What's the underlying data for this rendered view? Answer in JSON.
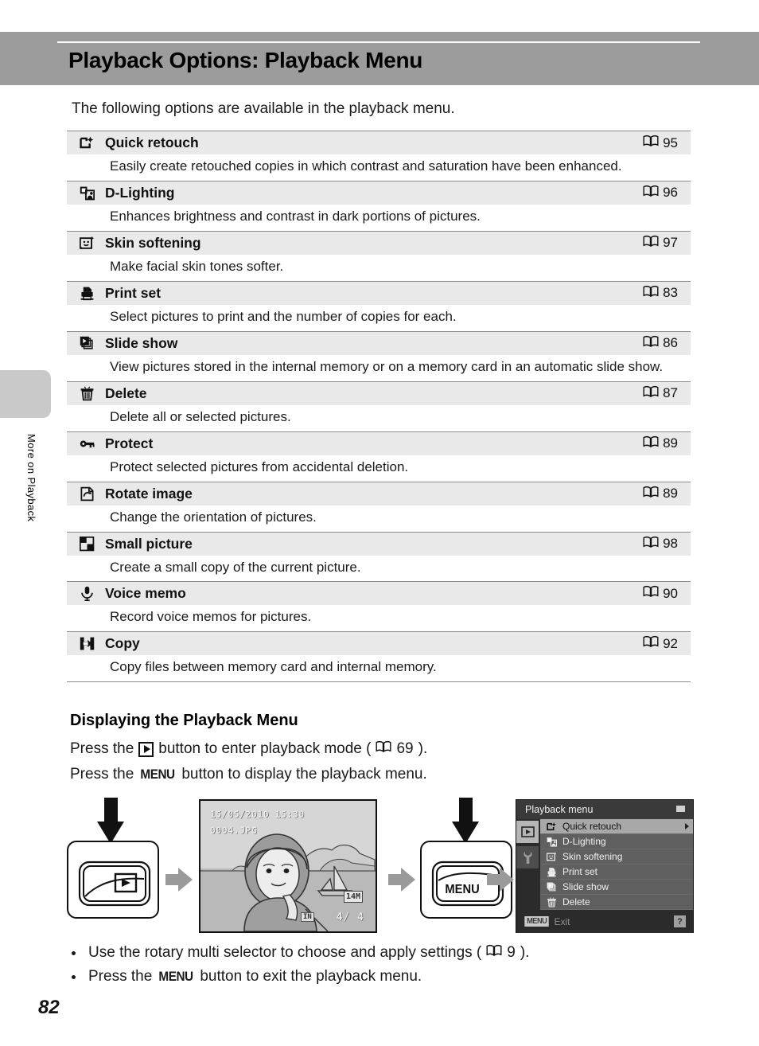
{
  "header": {
    "title": "Playback Options: Playback Menu"
  },
  "side_tab": {
    "label": "More on Playback"
  },
  "intro": "The following options are available in the playback menu.",
  "options_table": {
    "rows": [
      {
        "icon": "quick-retouch-icon",
        "name": "Quick retouch",
        "ref_icon": "book-icon",
        "ref_page": "95",
        "description": "Easily create retouched copies in which contrast and saturation have been enhanced."
      },
      {
        "icon": "d-lighting-icon",
        "name": "D-Lighting",
        "ref_icon": "book-icon",
        "ref_page": "96",
        "description": "Enhances brightness and contrast in dark portions of pictures."
      },
      {
        "icon": "skin-softening-icon",
        "name": "Skin softening",
        "ref_icon": "book-icon",
        "ref_page": "97",
        "description": "Make facial skin tones softer."
      },
      {
        "icon": "print-set-icon",
        "name": "Print set",
        "ref_icon": "book-icon",
        "ref_page": "83",
        "description": "Select pictures to print and the number of copies for each."
      },
      {
        "icon": "slide-show-icon",
        "name": "Slide show",
        "ref_icon": "book-icon",
        "ref_page": "86",
        "description": "View pictures stored in the internal memory or on a memory card in an automatic slide show."
      },
      {
        "icon": "delete-icon",
        "name": "Delete",
        "ref_icon": "book-icon",
        "ref_page": "87",
        "description": "Delete all or selected pictures."
      },
      {
        "icon": "protect-icon",
        "name": "Protect",
        "ref_icon": "book-icon",
        "ref_page": "89",
        "description": "Protect selected pictures from accidental deletion."
      },
      {
        "icon": "rotate-image-icon",
        "name": "Rotate image",
        "ref_icon": "book-icon",
        "ref_page": "89",
        "description": "Change the orientation of pictures."
      },
      {
        "icon": "small-picture-icon",
        "name": "Small picture",
        "ref_icon": "book-icon",
        "ref_page": "98",
        "description": "Create a small copy of the current picture."
      },
      {
        "icon": "voice-memo-icon",
        "name": "Voice memo",
        "ref_icon": "book-icon",
        "ref_page": "90",
        "description": "Record voice memos for pictures."
      },
      {
        "icon": "copy-icon",
        "name": "Copy",
        "ref_icon": "book-icon",
        "ref_page": "92",
        "description": "Copy files between memory card and internal memory."
      }
    ]
  },
  "section": {
    "heading": "Displaying the Playback Menu",
    "press_playback": {
      "before": "Press the",
      "button_icon": "playback-button-icon",
      "after": "button to enter playback mode (",
      "ref_icon": "book-icon",
      "ref_page": "69",
      "close": ")."
    },
    "press_menu": {
      "before": "Press the",
      "button_label": "MENU",
      "after": "button to display the playback menu."
    }
  },
  "flow": {
    "playback_button": {
      "label_icon": "playback-triangle-icon",
      "arrow": "press-arrow-down"
    },
    "lcd": {
      "date": "15/05/2010 15:30",
      "filename": "0004.JPG",
      "image_size_badge": "14M",
      "memory_badge": "IN",
      "frame_counter": "4/  4"
    },
    "menu_button": {
      "label": "MENU",
      "arrow": "press-arrow-down"
    },
    "menu_screen": {
      "title": "Playback menu",
      "battery_icon": "battery-icon",
      "tabs": [
        {
          "icon": "playback-tab-icon",
          "selected": true
        },
        {
          "icon": "setup-wrench-tab-icon",
          "selected": false
        }
      ],
      "items": [
        {
          "icon": "quick-retouch-icon",
          "label": "Quick retouch",
          "selected": true
        },
        {
          "icon": "d-lighting-icon",
          "label": "D-Lighting",
          "selected": false
        },
        {
          "icon": "skin-softening-icon",
          "label": "Skin softening",
          "selected": false
        },
        {
          "icon": "print-set-icon",
          "label": "Print set",
          "selected": false
        },
        {
          "icon": "slide-show-icon",
          "label": "Slide show",
          "selected": false
        },
        {
          "icon": "delete-icon",
          "label": "Delete",
          "selected": false
        }
      ],
      "footer": {
        "key": "MENU",
        "action": "Exit",
        "help_icon": "?"
      }
    }
  },
  "bullets": [
    {
      "before": "Use the rotary multi selector to choose and apply settings (",
      "ref_icon": "book-icon",
      "ref_page": "9",
      "after": ")."
    },
    {
      "before": "Press the",
      "key": "MENU",
      "after": "button to exit the playback menu."
    }
  ],
  "page_number": "82",
  "colors": {
    "header_band": "#9c9c9c",
    "row_band": "#e9e9e9",
    "side_tab": "#c9c9c9",
    "menu_screen_bg": "#2b2b2b",
    "menu_list_bg": "#5f5f5f",
    "menu_selected": "#a8a8a8"
  }
}
